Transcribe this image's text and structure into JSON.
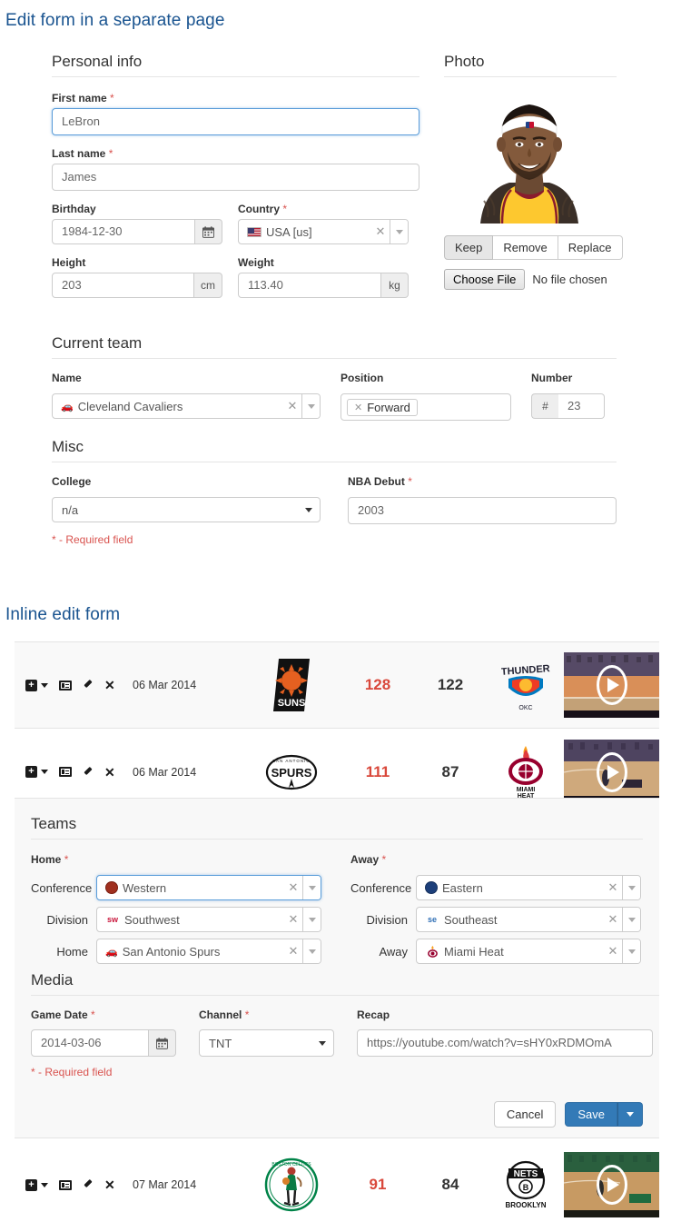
{
  "headings": {
    "separate_page": "Edit form in a separate page",
    "inline": "Inline edit form"
  },
  "separate_form": {
    "personal_info": {
      "legend": "Personal info",
      "first_name": {
        "label": "First name",
        "required": "*",
        "value": "LeBron"
      },
      "last_name": {
        "label": "Last name",
        "required": "*",
        "value": "James"
      },
      "birthday": {
        "label": "Birthday",
        "value": "1984-12-30",
        "icon": "calendar-icon"
      },
      "country": {
        "label": "Country",
        "required": "*",
        "value": "USA [us]",
        "flag": "us-flag-icon"
      },
      "height": {
        "label": "Height",
        "value": "203",
        "unit": "cm"
      },
      "weight": {
        "label": "Weight",
        "value": "113.40",
        "unit": "kg"
      }
    },
    "current_team": {
      "legend": "Current team",
      "name": {
        "label": "Name",
        "value": "Cleveland Cavaliers"
      },
      "position": {
        "label": "Position",
        "token": "Forward"
      },
      "number": {
        "label": "Number",
        "prefix": "#",
        "value": "23"
      }
    },
    "misc": {
      "legend": "Misc",
      "college": {
        "label": "College",
        "value": "n/a"
      },
      "nba_debut": {
        "label": "NBA Debut",
        "required": "*",
        "value": "2003"
      }
    },
    "required_note": "* - Required field",
    "photo": {
      "legend": "Photo",
      "buttons": [
        "Keep",
        "Remove",
        "Replace"
      ],
      "active_button": "Keep",
      "file_button": "Choose File",
      "file_status": "No file chosen"
    }
  },
  "table": {
    "rows": [
      {
        "date": "06 Mar 2014",
        "home_team": "Phoenix Suns",
        "home_score": "128",
        "away_score": "122",
        "away_team": "Oklahoma City Thunder",
        "video": "game-video-thumbnail"
      },
      {
        "date": "06 Mar 2014",
        "home_team": "San Antonio Spurs",
        "home_score": "111",
        "away_score": "87",
        "away_team": "Miami Heat",
        "video": "game-video-thumbnail"
      },
      {
        "date": "07 Mar 2014",
        "home_team": "Boston Celtics",
        "home_score": "91",
        "away_score": "84",
        "away_team": "Brooklyn Nets",
        "video": "game-video-thumbnail"
      }
    ],
    "row_actions": [
      "add-icon",
      "caret-down-icon",
      "details-icon",
      "edit-pencil-icon",
      "delete-x-icon"
    ]
  },
  "inline_form": {
    "teams": {
      "legend": "Teams",
      "home_group_label": "Home",
      "home_required": "*",
      "away_group_label": "Away",
      "away_required": "*",
      "home": [
        {
          "label": "Conference",
          "value": "Western",
          "badge": "west-logo-icon"
        },
        {
          "label": "Division",
          "value": "Southwest",
          "badge": "sw"
        },
        {
          "label": "Home",
          "value": "San Antonio Spurs",
          "badge": "car-icon"
        }
      ],
      "away": [
        {
          "label": "Conference",
          "value": "Eastern",
          "badge": "east-logo-icon"
        },
        {
          "label": "Division",
          "value": "Southeast",
          "badge": "se"
        },
        {
          "label": "Away",
          "value": "Miami Heat",
          "badge": "heat-logo-icon"
        }
      ]
    },
    "media": {
      "legend": "Media",
      "game_date": {
        "label": "Game Date",
        "required": "*",
        "value": "2014-03-06",
        "icon": "calendar-icon"
      },
      "channel": {
        "label": "Channel",
        "required": "*",
        "value": "TNT"
      },
      "recap": {
        "label": "Recap",
        "value": "https://youtube.com/watch?v=sHY0xRDMOmA"
      }
    },
    "required_note": "* - Required field",
    "buttons": {
      "cancel": "Cancel",
      "save": "Save",
      "save_caret": "caret-down-icon"
    }
  },
  "colors": {
    "heading": "#1a5490",
    "required": "#d9534f",
    "primary": "#337ab7",
    "score_home": "#d9483b",
    "panel_bg": "#f8f8f8"
  }
}
